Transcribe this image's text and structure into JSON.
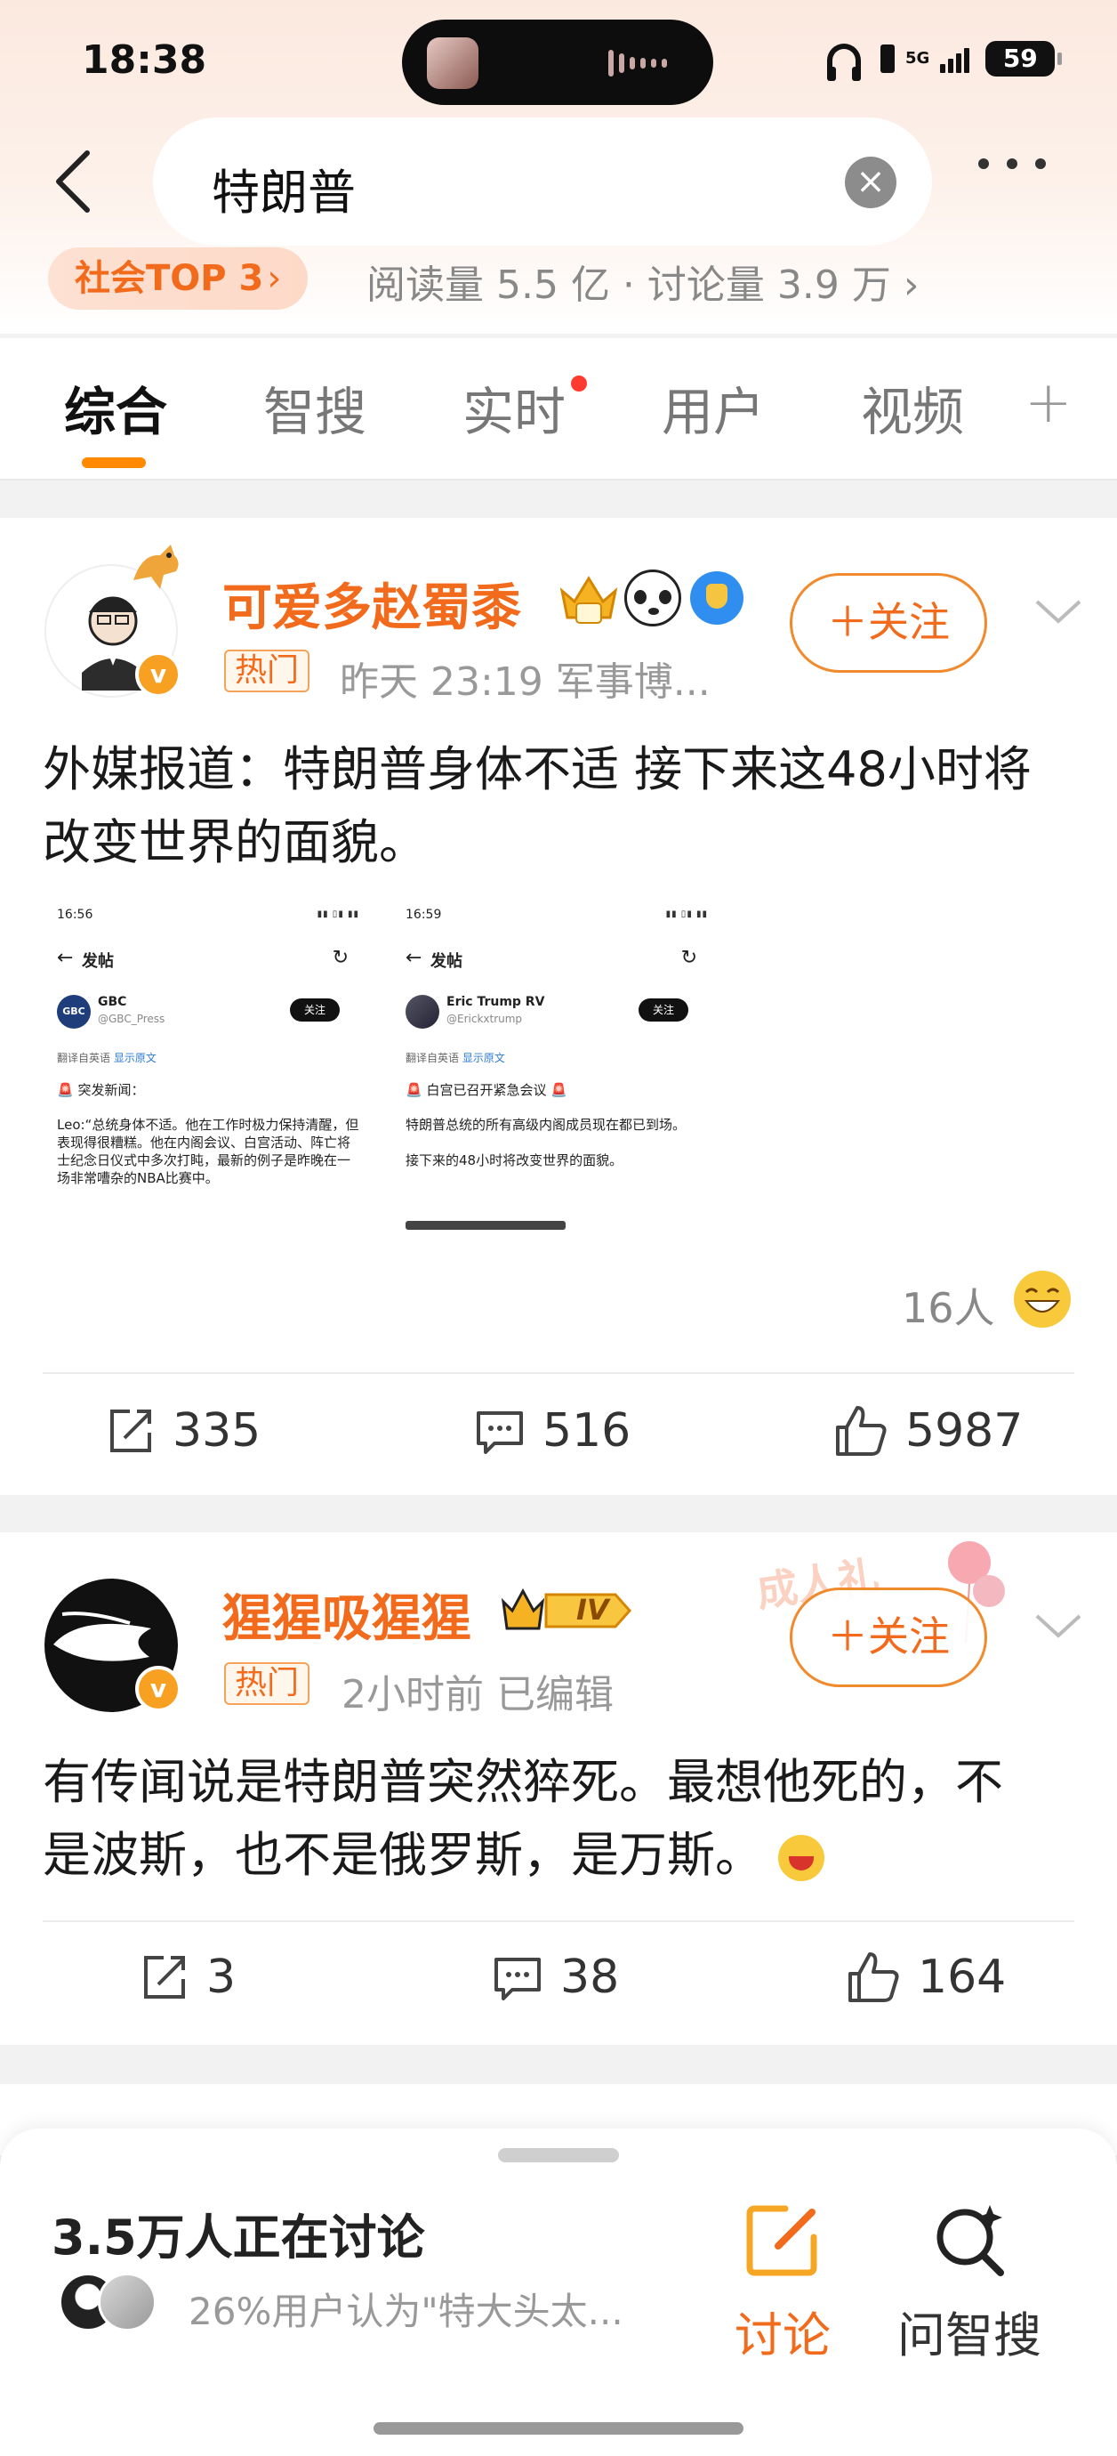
{
  "status_bar": {
    "time": "18:38",
    "network": "5G",
    "battery": "59"
  },
  "search": {
    "query": "特朗普"
  },
  "topic": {
    "rank_badge": "社会TOP 3",
    "stats": "阅读量 5.5 亿 · 讨论量 3.9 万"
  },
  "tabs": [
    {
      "label": "综合",
      "active": true
    },
    {
      "label": "智搜"
    },
    {
      "label": "实时",
      "has_dot": true
    },
    {
      "label": "用户"
    },
    {
      "label": "视频"
    }
  ],
  "posts": [
    {
      "author": "可爱多赵蜀黍",
      "tag": "热门",
      "meta": "昨天 23:19   军事博...",
      "follow_label": "＋关注",
      "text": "外媒报道：特朗普身体不适 接下来这48小时将改变世界的面貌。",
      "reactors": "16人",
      "reposts": "335",
      "comments": "516",
      "likes": "5987",
      "images": [
        {
          "time": "16:56",
          "title": "发帖",
          "account_name": "GBC",
          "handle": "@GBC_Press",
          "avatar_text": "GBC",
          "follow": "关注",
          "translate": "翻译自英语",
          "show_original": "显示原文",
          "alert": "🚨 突发新闻：",
          "body": "Leo:“总统身体不适。他在工作时极力保持清醒，但表现得很糟糕。他在内阁会议、白宫活动、阵亡将士纪念日仪式中多次打盹，最新的例子是昨晚在一场非常嘈杂的NBA比赛中。"
        },
        {
          "time": "16:59",
          "title": "发帖",
          "account_name": "Eric Trump RV",
          "handle": "@Erickxtrump",
          "avatar_text": "",
          "follow": "关注",
          "translate": "翻译自英语",
          "show_original": "显示原文",
          "alert": "🚨 白宫已召开紧急会议 🚨",
          "body": "特朗普总统的所有高级内阁成员现在都已到场。\n\n接下来的48小时将改变世界的面貌。"
        }
      ]
    },
    {
      "author": "猩猩吸猩猩",
      "tag": "热门",
      "meta": "2小时前    已编辑",
      "follow_label": "＋关注",
      "level_badge": "IV",
      "decoration": "成人礼",
      "text": "有传闻说是特朗普突然猝死。最想他死的，不是波斯，也不是俄罗斯，是万斯。",
      "reposts": "3",
      "comments": "38",
      "likes": "164"
    }
  ],
  "bottom_sheet": {
    "discussing": "3.5万人正在讨论",
    "opinion": "26%用户认为\"特大头太...",
    "discuss_label": "讨论",
    "ask_label": "问智搜"
  },
  "colors": {
    "accent": "#f26a1b",
    "tab_underline": "#ff8a00",
    "red_dot": "#ff3b30"
  }
}
